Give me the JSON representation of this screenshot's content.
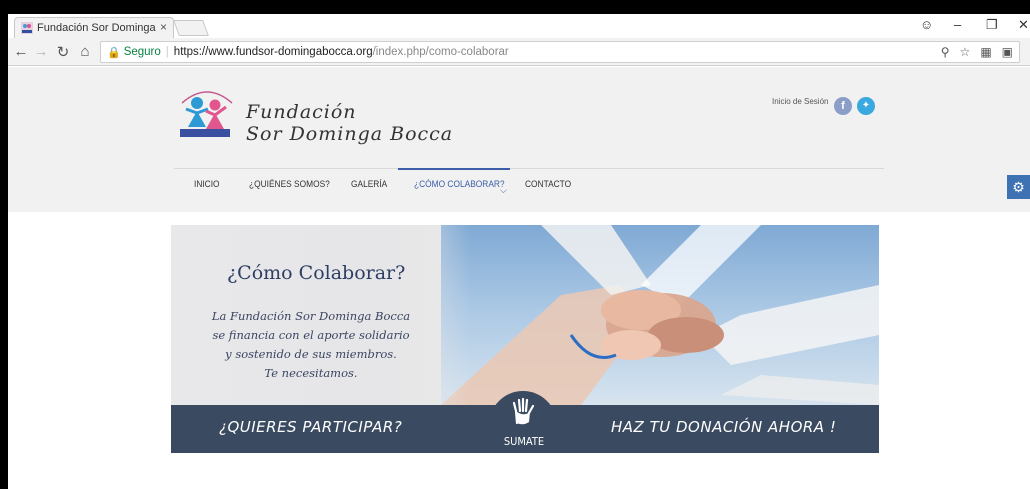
{
  "browser": {
    "tab_title": "Fundación Sor Dominga",
    "tab_close": "×",
    "security_label": "Seguro",
    "url_host": "https://www.fundsor-domingabocca.org",
    "url_path": "/index.php/como-colaborar"
  },
  "header": {
    "org_name_line1": "Fundación",
    "org_name_line2": "Sor Dominga Bocca",
    "login_link": "Inicio de Sesión",
    "facebook_glyph": "f",
    "twitter_glyph": "t"
  },
  "nav": {
    "items": [
      {
        "label": "INICIO"
      },
      {
        "label": "¿QUIÉNES SOMOS?"
      },
      {
        "label": "GALERÍA"
      },
      {
        "label": "¿CÓMO COLABORAR?",
        "active": true
      },
      {
        "label": "CONTACTO"
      }
    ]
  },
  "banner": {
    "title": "¿Cómo Colaborar?",
    "text_line1": "La Fundación Sor Dominga Bocca",
    "text_line2": "se financia con el aporte solidario",
    "text_line3": "y sostenido de sus miembros.",
    "text_line4": "Te necesitamos.",
    "cta_left": "¿QUIERES PARTICIPAR?",
    "cta_center": "SUMATE",
    "cta_right": "HAZ TU DONACIÓN AHORA !"
  },
  "colors": {
    "nav_active": "#3c5da8",
    "banner_bar": "#3a4a60",
    "gear_button": "#3e72b3",
    "secure_green": "#0b8043"
  },
  "icons": [
    "favicon",
    "close-icon",
    "back-icon",
    "forward-icon",
    "reload-icon",
    "home-icon",
    "lock-icon",
    "zoom-icon",
    "star-icon",
    "facebook-icon",
    "twitter-icon",
    "gear-icon",
    "hand-icon"
  ]
}
